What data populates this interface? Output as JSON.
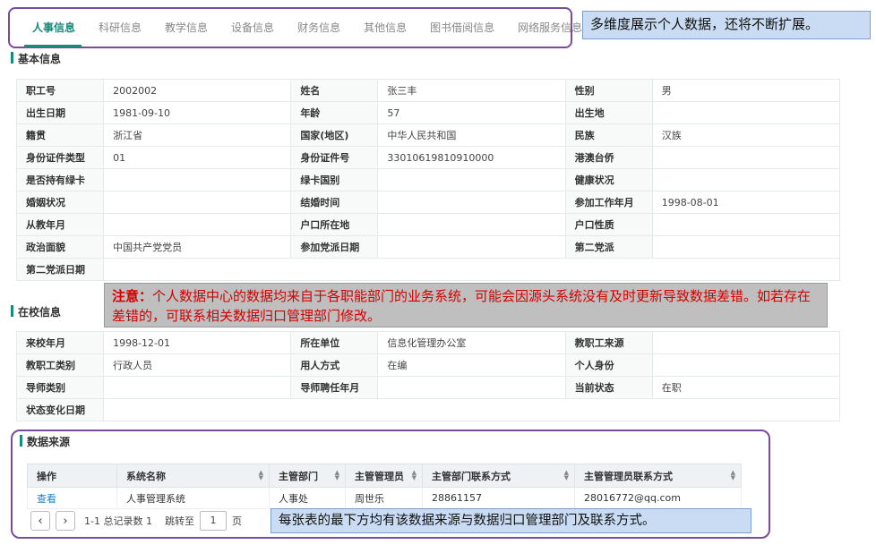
{
  "tabs": [
    "人事信息",
    "科研信息",
    "教学信息",
    "设备信息",
    "财务信息",
    "其他信息",
    "图书借阅信息",
    "网络服务信息"
  ],
  "callout_top": "多维度展示个人数据，还将不断扩展。",
  "sections": {
    "basic": "基本信息",
    "school": "在校信息",
    "source": "数据来源"
  },
  "basic_rows": [
    [
      "职工号",
      "2002002",
      "姓名",
      "张三丰",
      "性别",
      "男"
    ],
    [
      "出生日期",
      "1981-09-10",
      "年龄",
      "57",
      "出生地",
      ""
    ],
    [
      "籍贯",
      "浙江省",
      "国家(地区)",
      "中华人民共和国",
      "民族",
      "汉族"
    ],
    [
      "身份证件类型",
      "01",
      "身份证件号",
      "33010619810910000",
      "港澳台侨",
      ""
    ],
    [
      "是否持有绿卡",
      "",
      "绿卡国别",
      "",
      "健康状况",
      ""
    ],
    [
      "婚姻状况",
      "",
      "结婚时间",
      "",
      "参加工作年月",
      "1998-08-01"
    ],
    [
      "从教年月",
      "",
      "户口所在地",
      "",
      "户口性质",
      ""
    ],
    [
      "政治面貌",
      "中国共产党党员",
      "参加党派日期",
      "",
      "第二党派",
      ""
    ],
    [
      "第二党派日期",
      ""
    ]
  ],
  "notice": {
    "prefix": "注意：",
    "text": "个人数据中心的数据均来自于各职能部门的业务系统，可能会因源头系统没有及时更新导致数据差错。如若存在差错的，可联系相关数据归口管理部门修改。"
  },
  "school_rows": [
    [
      "来校年月",
      "1998-12-01",
      "所在单位",
      "信息化管理办公室",
      "教职工来源",
      ""
    ],
    [
      "教职工类别",
      "行政人员",
      "用人方式",
      "在编",
      "个人身份",
      ""
    ],
    [
      "导师类别",
      "",
      "导师聘任年月",
      "",
      "当前状态",
      "在职"
    ],
    [
      "状态变化日期",
      ""
    ]
  ],
  "source_table": {
    "headers": [
      "操作",
      "系统名称",
      "主管部门",
      "主管管理员",
      "主管部门联系方式",
      "主管管理员联系方式"
    ],
    "rows": [
      [
        "查看",
        "人事管理系统",
        "人事处",
        "周世乐",
        "28861157",
        "28016772@qq.com"
      ]
    ]
  },
  "pager": {
    "summary": "1-1 总记录数 1",
    "jump_label": "跳转至",
    "page": "1",
    "page_unit": "页"
  },
  "callout_bottom": "每张表的最下方均有该数据来源与数据归口管理部门及联系方式。",
  "colors": {
    "accent": "#1a8a7a",
    "frame": "#7a4aa0",
    "callout": "#c9dcf3",
    "notice_text": "#d40000"
  }
}
